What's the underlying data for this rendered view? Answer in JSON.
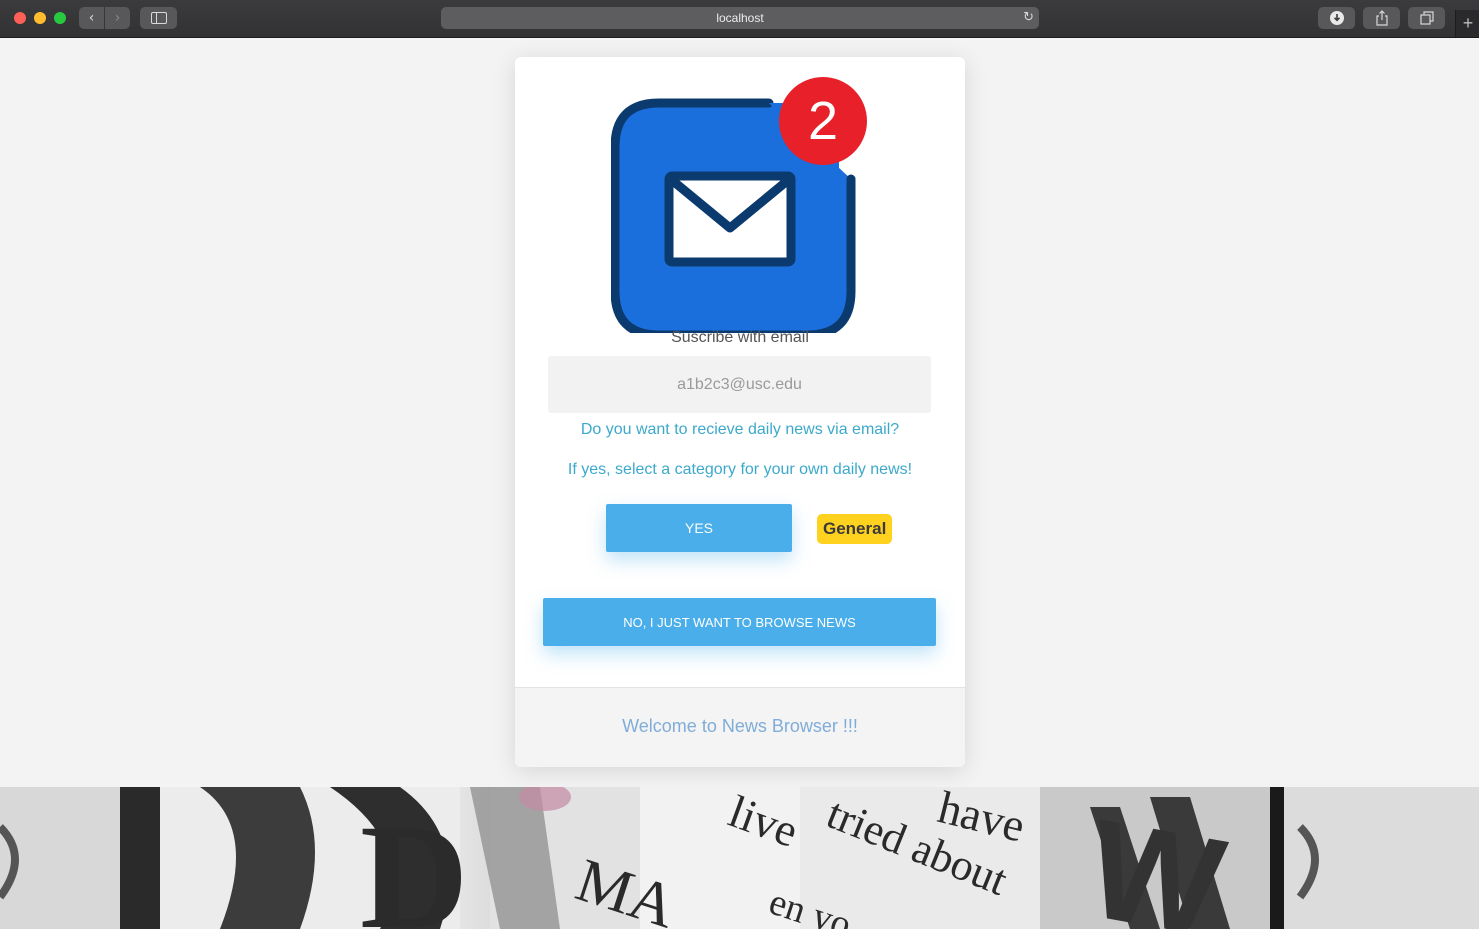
{
  "browser": {
    "url": "localhost"
  },
  "card": {
    "notification_count": "2",
    "subscribe_label": "Suscribe with email",
    "email_placeholder": "a1b2c3@usc.edu",
    "question_1": "Do you want to recieve daily news via email?",
    "question_2": "If yes, select a category for your own daily news!",
    "yes_label": "YES",
    "category_label": "General",
    "no_label": "NO, I JUST WANT TO BROWSE NEWS",
    "welcome_text": "Welcome to News Browser !!!"
  },
  "banner": {
    "headline_words": [
      "have",
      "tried about",
      "live",
      "MA",
      "en yo",
      "D",
      "W"
    ]
  },
  "colors": {
    "button_blue": "#4aaeea",
    "question_text": "#3ca9cc",
    "category_yellow": "#ffd21f",
    "badge_red": "#e8202a",
    "icon_blue": "#1b6fdc",
    "icon_outline": "#0b3a6e",
    "welcome_text": "#7fadd8"
  },
  "icons": {
    "mail": "envelope-icon",
    "badge": "notification-badge"
  }
}
